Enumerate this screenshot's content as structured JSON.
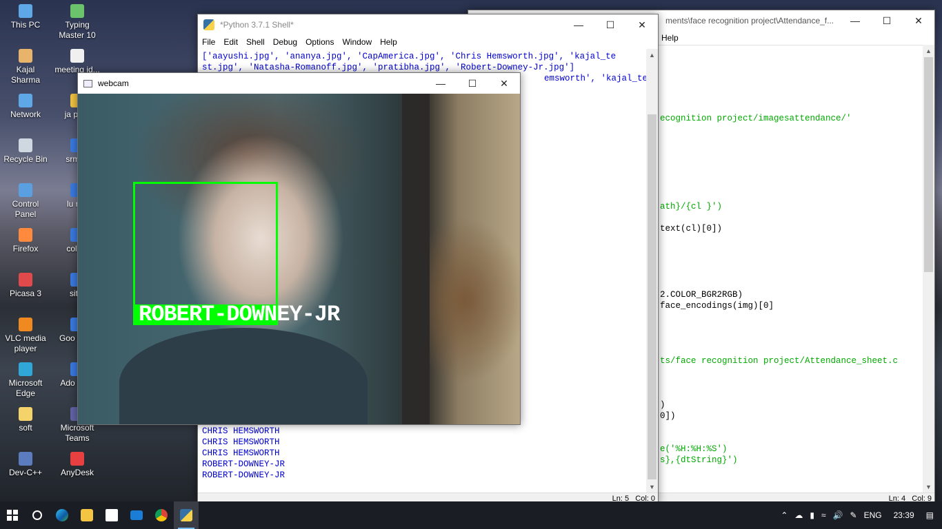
{
  "desktop": {
    "icons": [
      {
        "label": "This PC"
      },
      {
        "label": "Typing Master 10"
      },
      {
        "label": "Kajal Sharma"
      },
      {
        "label": "meeting id..."
      },
      {
        "label": "Network"
      },
      {
        "label": "ja prog"
      },
      {
        "label": "Recycle Bin"
      },
      {
        "label": "srmgp"
      },
      {
        "label": "Control Panel"
      },
      {
        "label": "lu reg"
      },
      {
        "label": "Firefox"
      },
      {
        "label": "colleg"
      },
      {
        "label": "Picasa 3"
      },
      {
        "label": "site."
      },
      {
        "label": "VLC media player"
      },
      {
        "label": "Goo Chro"
      },
      {
        "label": "Microsoft Edge"
      },
      {
        "label": "Ado Phot"
      },
      {
        "label": "soft"
      },
      {
        "label": "Microsoft Teams"
      },
      {
        "label": "Dev-C++"
      },
      {
        "label": "AnyDesk"
      }
    ]
  },
  "shell": {
    "title": "*Python 3.7.1 Shell*",
    "menu": [
      "File",
      "Edit",
      "Shell",
      "Debug",
      "Options",
      "Window",
      "Help"
    ],
    "output_top": [
      "['aayushi.jpg', 'ananya.jpg', 'CapAmerica.jpg', 'Chris Hemsworth.jpg', 'kajal_te",
      "st.jpg', 'Natasha-Romanoff.jpg', 'pratibha.jpg', 'Robert-Downey-Jr.jpg']",
      "emsworth', 'kajal_test"
    ],
    "output_bottom": [
      "CHRIS HEMSWORTH",
      "CHRIS HEMSWORTH",
      "CHRIS HEMSWORTH",
      "ROBERT-DOWNEY-JR",
      "ROBERT-DOWNEY-JR"
    ],
    "status": "Ln: 5   Col: 0"
  },
  "editor": {
    "title": "ments\\face recognition project\\Attendance_f...",
    "menu_partial": "Help",
    "lines": [
      {
        "text": "ecognition project/imagesattendance/'",
        "color": "green"
      },
      {
        "text": "ath}/{cl }')",
        "color": "green"
      },
      {
        "text": "text(cl)[0])",
        "color": "black"
      },
      {
        "text": "2.COLOR_BGR2RGB)",
        "color": "black"
      },
      {
        "text": "face_encodings(img)[0]",
        "color": "black"
      },
      {
        "text": "ts/face recognition project/Attendance_sheet.c",
        "color": "green"
      },
      {
        "text": ")",
        "color": "black"
      },
      {
        "text": "0])",
        "color": "black"
      },
      {
        "text": "e('%H:%H:%S')",
        "color": "green"
      },
      {
        "text": "s},{dtString}')",
        "color": "green"
      }
    ],
    "status": "Ln: 4   Col: 9"
  },
  "webcam": {
    "title": "webcam",
    "face_label": "ROBERT-DOWNEY-JR",
    "box_color": "#00ff00"
  },
  "taskbar": {
    "apps": [
      "windows-start",
      "search",
      "edge",
      "file-explorer",
      "store",
      "mail",
      "chrome",
      "python-idle"
    ],
    "language": "ENG",
    "time": "23:39"
  }
}
